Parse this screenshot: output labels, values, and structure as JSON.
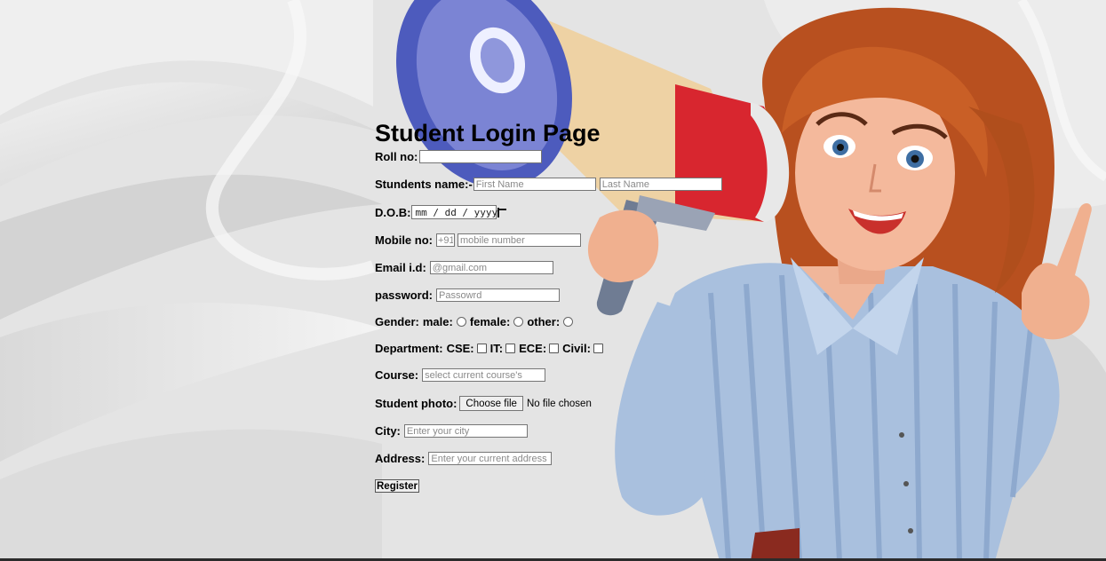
{
  "form": {
    "title": "Student Login Page",
    "roll": {
      "label": "Roll no:",
      "value": ""
    },
    "name": {
      "label": "Stundents name:-",
      "first_placeholder": "First Name",
      "last_placeholder": "Last Name"
    },
    "dob": {
      "label": "D.O.B:",
      "value": "mm / dd / yyyy"
    },
    "mobile": {
      "label": "Mobile no:",
      "code_placeholder": "+91",
      "placeholder": "mobile number"
    },
    "email": {
      "label": "Email i.d:",
      "placeholder": "@gmail.com"
    },
    "password": {
      "label": "password:",
      "placeholder": "Passowrd"
    },
    "gender": {
      "label": "Gender:",
      "options": [
        "male:",
        "female:",
        "other:"
      ]
    },
    "department": {
      "label": "Department:",
      "options": [
        "CSE:",
        "IT:",
        "ECE:",
        "Civil:"
      ]
    },
    "course": {
      "label": "Course:",
      "placeholder": "select current course's"
    },
    "photo": {
      "label": "Student photo:",
      "button": "Choose file",
      "status": "No file chosen"
    },
    "city": {
      "label": "City:",
      "placeholder": "Enter your city"
    },
    "address": {
      "label": "Address:",
      "placeholder": "Enter your current address"
    },
    "submit_label": "Register"
  },
  "colors": {
    "background": "#e6e6e6",
    "shirt": "#9fb8d8",
    "hair": "#c45a22",
    "megaphone_red": "#d8262f",
    "megaphone_blue": "#5a67c6"
  },
  "illustration": "woman-with-megaphone"
}
